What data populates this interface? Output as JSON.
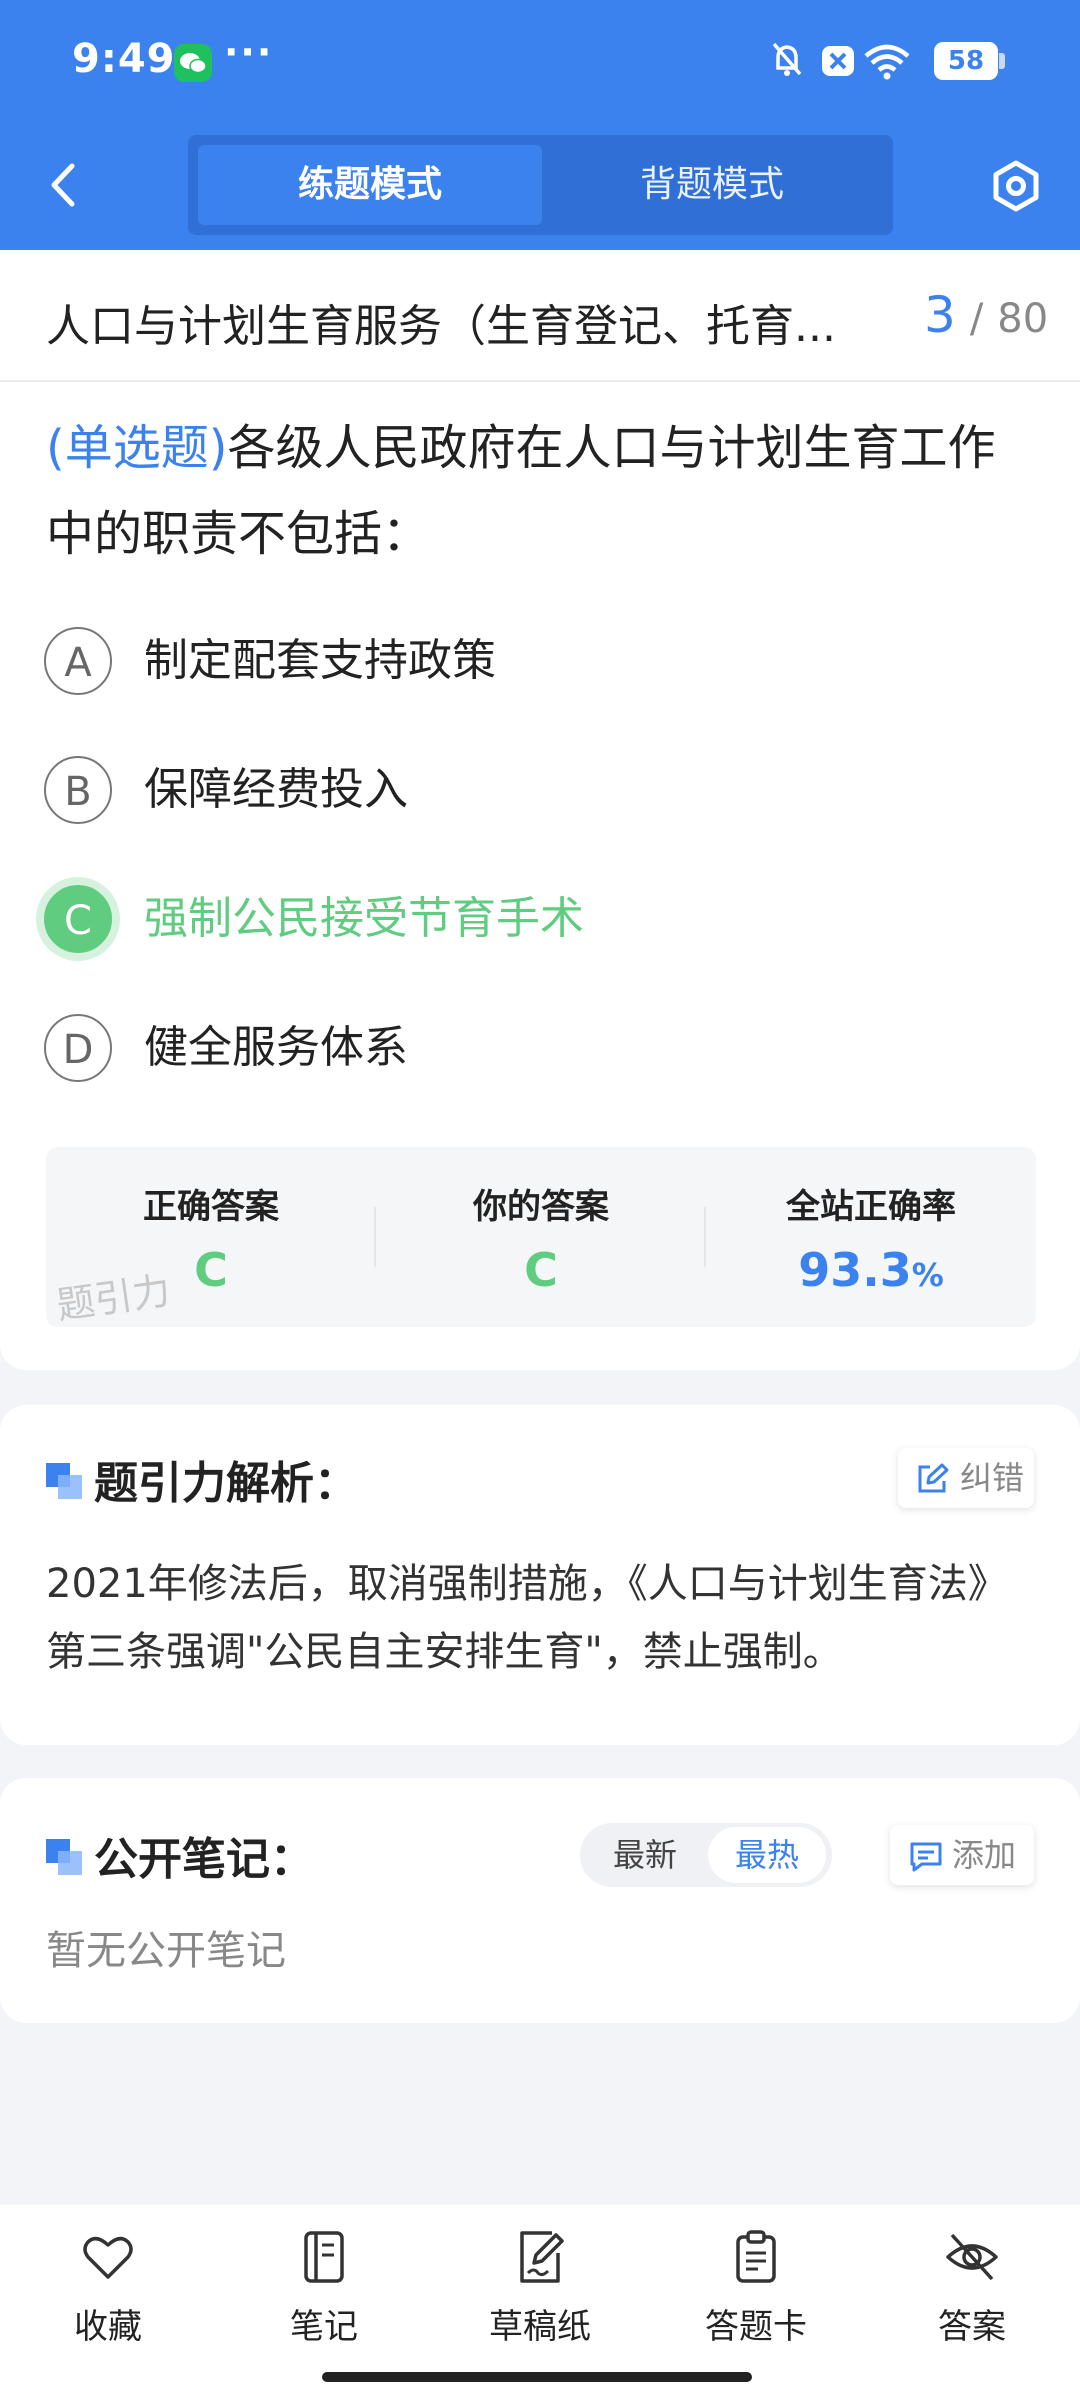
{
  "status_bar": {
    "time": "9:49",
    "dots": "···",
    "battery": "58"
  },
  "header": {
    "mode_practice": "练题模式",
    "mode_memorize": "背题模式"
  },
  "question_header": {
    "title": "人口与计划生育服务（生育登记、托育...",
    "current": "3",
    "separator": "/",
    "total": "80"
  },
  "question": {
    "type": "(单选题)",
    "text": "各级人民政府在人口与计划生育工作中的职责不包括：",
    "options": [
      {
        "letter": "A",
        "text": "制定配套支持政策"
      },
      {
        "letter": "B",
        "text": "保障经费投入"
      },
      {
        "letter": "C",
        "text": "强制公民接受节育手术"
      },
      {
        "letter": "D",
        "text": "健全服务体系"
      }
    ]
  },
  "stats": {
    "correct_label": "正确答案",
    "correct_value": "C",
    "yours_label": "你的答案",
    "yours_value": "C",
    "rate_label": "全站正确率",
    "rate_value": "93.3",
    "rate_unit": "%",
    "watermark": "题引力"
  },
  "analysis": {
    "title": "题引力解析：",
    "report_label": "纠错",
    "text": "2021年修法后，取消强制措施，《人口与计划生育法》第三条强调\"公民自主安排生育\"，禁止强制。"
  },
  "notes": {
    "title": "公开笔记：",
    "sort_latest": "最新",
    "sort_hot": "最热",
    "add_label": "添加",
    "empty": "暂无公开笔记"
  },
  "bottom_tabs": [
    {
      "label": "收藏"
    },
    {
      "label": "笔记"
    },
    {
      "label": "草稿纸"
    },
    {
      "label": "答题卡"
    },
    {
      "label": "答案"
    }
  ],
  "colors": {
    "primary": "#3c82ef",
    "correct": "#5fcc7f"
  }
}
